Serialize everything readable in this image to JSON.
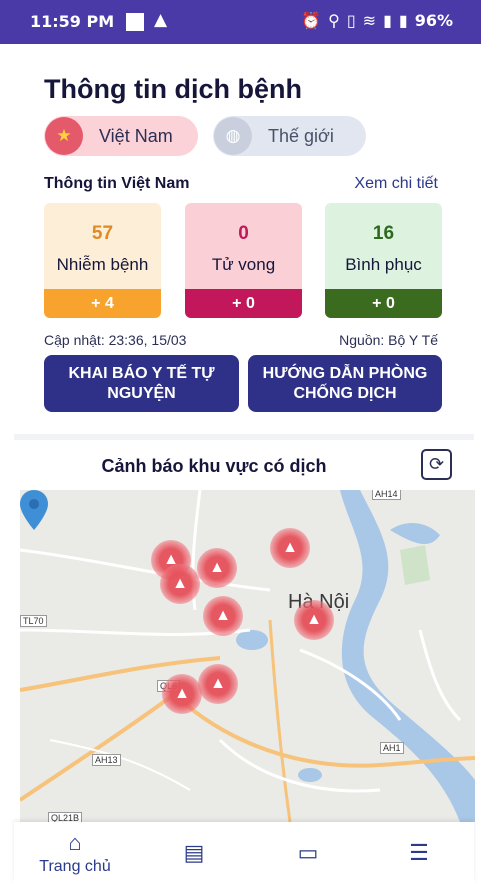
{
  "status_bar": {
    "time": "11:59 PM",
    "battery": "96%",
    "icons": [
      "alarm-icon",
      "location-icon",
      "vibrate-icon",
      "wifi-icon",
      "signal-icon",
      "battery-icon"
    ]
  },
  "page": {
    "title": "Thông tin dịch bệnh"
  },
  "region_tabs": [
    {
      "label": "Việt Nam",
      "icon": "star-flag-icon",
      "selected": true
    },
    {
      "label": "Thế giới",
      "icon": "globe-icon",
      "selected": false
    }
  ],
  "summary": {
    "heading": "Thông tin Việt Nam",
    "detail_link": "Xem chi tiết",
    "cards": [
      {
        "value": "57",
        "label": "Nhiễm bệnh",
        "delta": "+ 4",
        "color": "#f7a32e"
      },
      {
        "value": "0",
        "label": "Tử vong",
        "delta": "+ 0",
        "color": "#c2185b"
      },
      {
        "value": "16",
        "label": "Bình phục",
        "delta": "+ 0",
        "color": "#3a6b1f"
      }
    ],
    "updated": "Cập nhật: 23:36, 15/03",
    "source": "Nguồn: Bộ Y Tế"
  },
  "actions": {
    "declare": "KHAI BÁO Y TẾ TỰ NGUYỆN",
    "guide": "HƯỚNG DẪN PHÒNG CHỐNG DỊCH"
  },
  "map_section": {
    "title": "Cảnh báo khu vực có dịch",
    "city_label": "Hà Nội",
    "road_tags": [
      "AH14",
      "TL70",
      "QL6",
      "AH13",
      "AH1",
      "QL21B"
    ]
  },
  "bottom_nav": {
    "home_label": "Trang chủ",
    "items": [
      "home-icon",
      "chart-icon",
      "chat-icon",
      "menu-icon"
    ]
  },
  "colors": {
    "primary": "#2e3187",
    "status_bar": "#4a3aa8",
    "alert": "#e6505a"
  }
}
